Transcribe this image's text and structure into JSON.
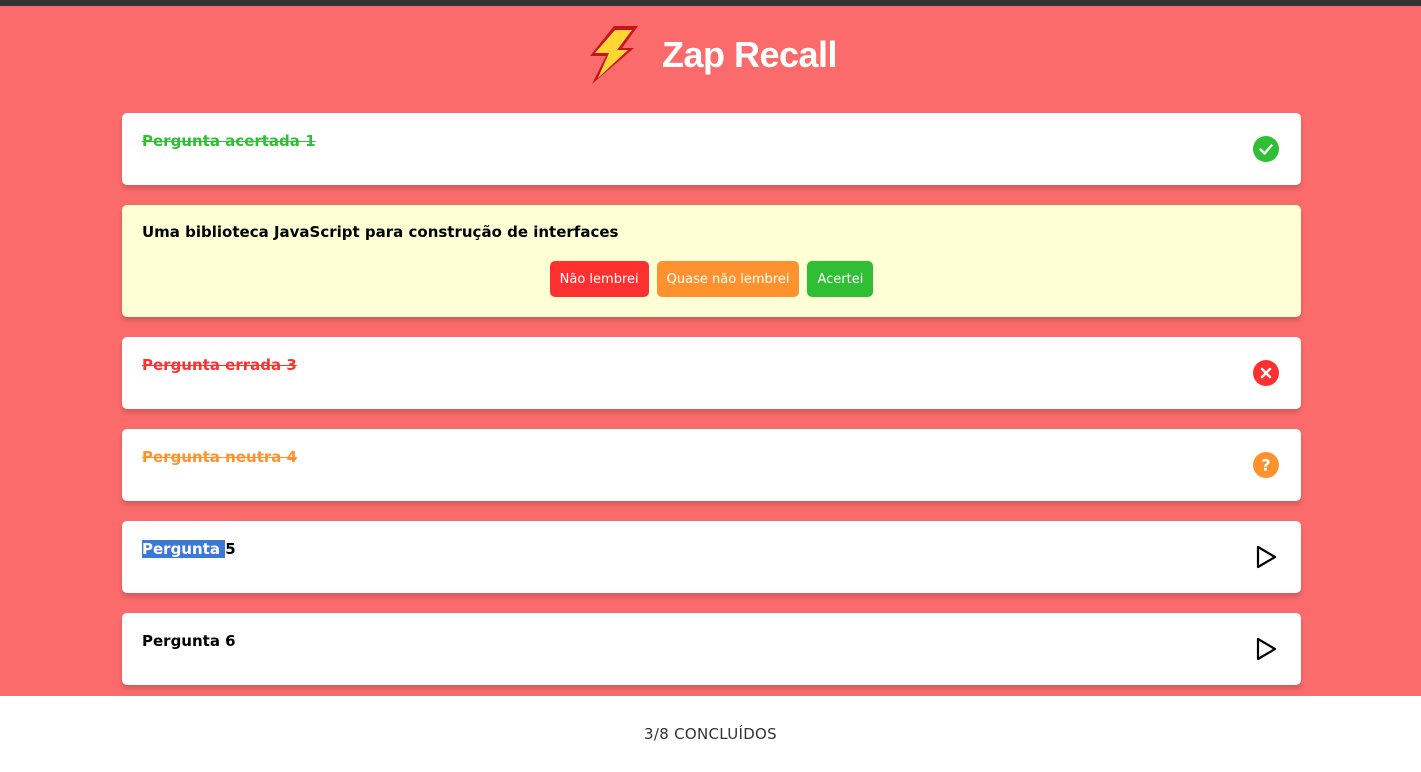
{
  "app": {
    "title": "Zap Recall",
    "logo_icon": "lightning-bolt-icon"
  },
  "colors": {
    "background": "#FB6B6B",
    "correct": "#2FBE34",
    "wrong": "#FF3030",
    "almost": "#FF922E",
    "answer_card": "#FFFFD5"
  },
  "cards": [
    {
      "label": "Pergunta acertada 1",
      "status": "correct",
      "icon": "check-circle-icon"
    },
    {
      "answer": "Uma biblioteca JavaScript para construção de interfaces",
      "status": "open",
      "buttons": {
        "forgot": "Não lembrei",
        "almost": "Quase não lembrei",
        "correct": "Acertei"
      }
    },
    {
      "label": "Pergunta errada 3",
      "status": "wrong",
      "icon": "close-circle-icon"
    },
    {
      "label": "Pergunta neutra 4",
      "status": "almost",
      "icon": "help-circle-icon"
    },
    {
      "label_selected": "Pergunta ",
      "label_rest": "5",
      "status": "closed",
      "icon": "play-icon"
    },
    {
      "label": "Pergunta 6",
      "status": "closed",
      "icon": "play-icon"
    }
  ],
  "footer": {
    "progress_text": "3/8 CONCLUÍDOS"
  }
}
